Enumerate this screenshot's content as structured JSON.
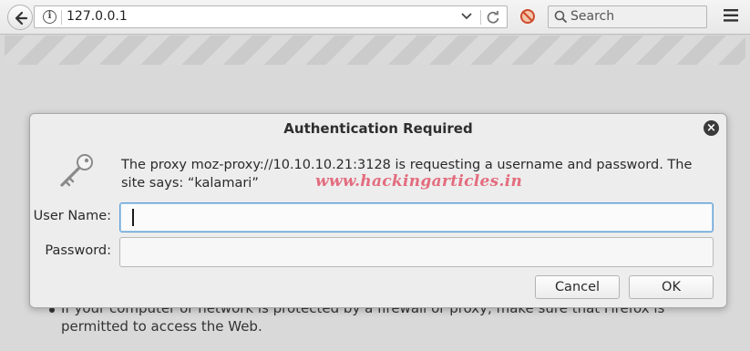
{
  "browser": {
    "url": "127.0.0.1",
    "search_placeholder": "Search",
    "icons": {
      "back": "back-arrow-icon",
      "info": "info-icon",
      "dropdown": "chevron-down-icon",
      "reload": "reload-icon",
      "tracking": "block-icon",
      "search": "search-icon",
      "menu": "hamburger-menu-icon"
    }
  },
  "page": {
    "bullet_text": "If your computer or network is protected by a firewall or proxy, make sure that Firefox is permitted to access the Web."
  },
  "dialog": {
    "title": "Authentication Required",
    "close_symbol": "×",
    "message": "The proxy moz-proxy://10.10.10.21:3128 is requesting a username and password. The site says: “kalamari”",
    "watermark": "www.hackingarticles.in",
    "username_label": "User Name:",
    "username_value": "",
    "password_label": "Password:",
    "password_value": "",
    "cancel_label": "Cancel",
    "ok_label": "OK",
    "icon": "key-icon"
  },
  "colors": {
    "dialog_bg": "#ededed",
    "focus_border": "#5f9fd6",
    "watermark": "#e2566b"
  }
}
